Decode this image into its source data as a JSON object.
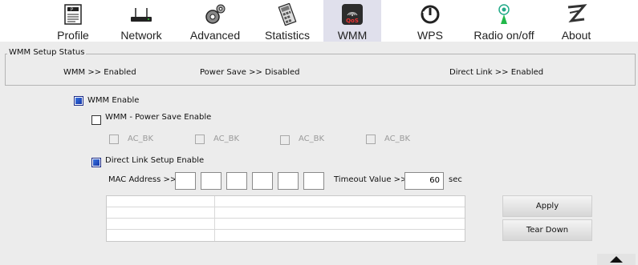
{
  "tabs": [
    {
      "label": "Profile",
      "icon": "profile-icon"
    },
    {
      "label": "Network",
      "icon": "network-icon"
    },
    {
      "label": "Advanced",
      "icon": "advanced-gear-icon"
    },
    {
      "label": "Statistics",
      "icon": "statistics-icon"
    },
    {
      "label": "WMM",
      "icon": "qos-icon"
    },
    {
      "label": "WPS",
      "icon": "wps-icon"
    },
    {
      "label": "Radio on/off",
      "icon": "radio-antenna-icon"
    },
    {
      "label": "About",
      "icon": "about-logo-icon"
    }
  ],
  "active_tab": "WMM",
  "qos_badge": "QoS",
  "status": {
    "legend": "WMM Setup Status",
    "wmm": "WMM >> Enabled",
    "power_save": "Power Save >> Disabled",
    "direct_link": "Direct Link >> Enabled"
  },
  "options": {
    "wmm_enable": {
      "label": "WMM Enable",
      "checked": true
    },
    "power_save_enable": {
      "label": "WMM - Power Save Enable",
      "checked": false
    },
    "ac_items": [
      "AC_BK",
      "AC_BK",
      "AC_BK",
      "AC_BK"
    ],
    "dls_enable": {
      "label": "Direct Link Setup Enable",
      "checked": true
    }
  },
  "mac": {
    "label": "MAC Address >>",
    "octets": [
      "",
      "",
      "",
      "",
      "",
      ""
    ]
  },
  "timeout": {
    "label": "Timeout Value >>",
    "value": "60",
    "unit": "sec"
  },
  "buttons": {
    "apply": "Apply",
    "tear_down": "Tear Down"
  },
  "colors": {
    "active_tab": "#e0e0ec",
    "checkbox_fill": "#1436a8"
  }
}
